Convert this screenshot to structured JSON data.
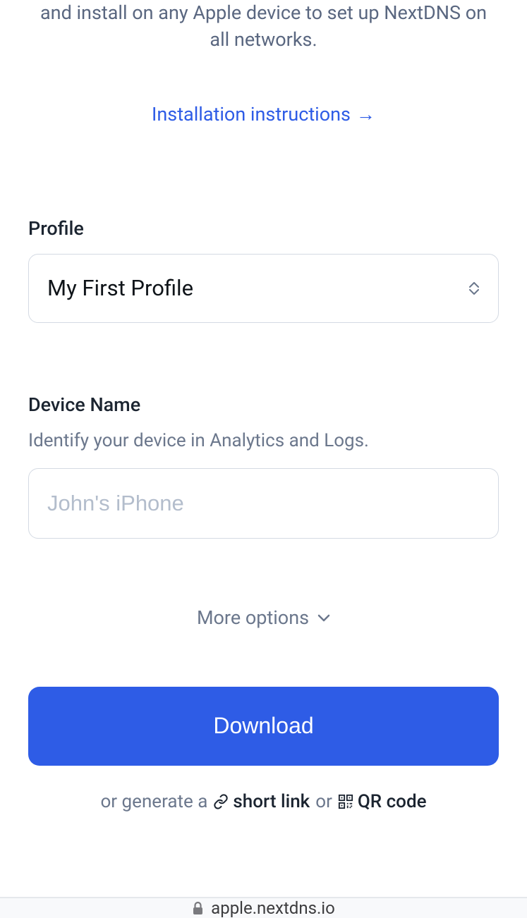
{
  "intro": {
    "text": "and install on any Apple device to set up NextDNS on all networks."
  },
  "instructions_link": {
    "label": "Installation instructions",
    "arrow": "→"
  },
  "profile": {
    "label": "Profile",
    "selected": "My First Profile"
  },
  "device": {
    "label": "Device Name",
    "sublabel": "Identify your device in Analytics and Logs.",
    "placeholder": "John's iPhone"
  },
  "more_options": {
    "label": "More options"
  },
  "download": {
    "label": "Download"
  },
  "generate": {
    "prefix": "or generate a",
    "short_link": "short link",
    "or": "or",
    "qr_code": "QR code"
  },
  "url_bar": {
    "domain": "apple.nextdns.io"
  }
}
